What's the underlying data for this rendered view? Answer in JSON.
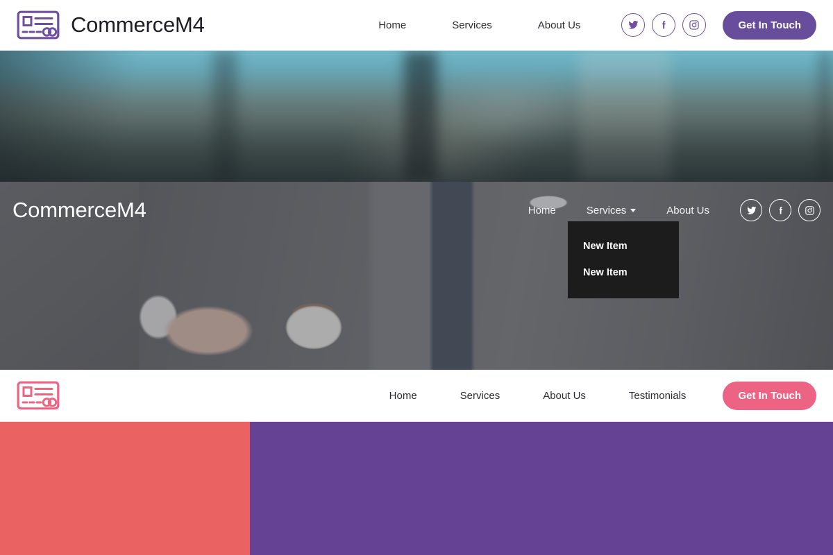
{
  "header_one": {
    "brand": "CommerceM4",
    "logo_icon": "id-card-icon",
    "nav": [
      {
        "label": "Home"
      },
      {
        "label": "Services"
      },
      {
        "label": "About Us"
      }
    ],
    "social": [
      {
        "name": "twitter-icon",
        "label": "Twitter"
      },
      {
        "name": "facebook-icon",
        "label": "Facebook"
      },
      {
        "name": "instagram-icon",
        "label": "Instagram"
      }
    ],
    "cta_label": "Get In Touch",
    "accent_color": "#674d9c"
  },
  "header_two": {
    "brand": "CommerceM4",
    "nav": [
      {
        "label": "Home",
        "has_dropdown": false
      },
      {
        "label": "Services",
        "has_dropdown": true
      },
      {
        "label": "About Us",
        "has_dropdown": false
      }
    ],
    "dropdown": {
      "open": true,
      "parent": "Services",
      "items": [
        {
          "label": "New Item"
        },
        {
          "label": "New Item"
        }
      ],
      "background_color": "#1c1c1c"
    },
    "social": [
      {
        "name": "twitter-icon",
        "label": "Twitter"
      },
      {
        "name": "facebook-icon",
        "label": "Facebook"
      },
      {
        "name": "instagram-icon",
        "label": "Instagram"
      }
    ]
  },
  "header_three": {
    "logo_icon": "id-card-icon",
    "nav": [
      {
        "label": "Home"
      },
      {
        "label": "Services"
      },
      {
        "label": "About Us"
      },
      {
        "label": "Testimonials"
      }
    ],
    "cta_label": "Get In Touch",
    "accent_color": "#ec6383"
  },
  "color_blocks": {
    "coral": "#ea6261",
    "purple": "#654293"
  }
}
